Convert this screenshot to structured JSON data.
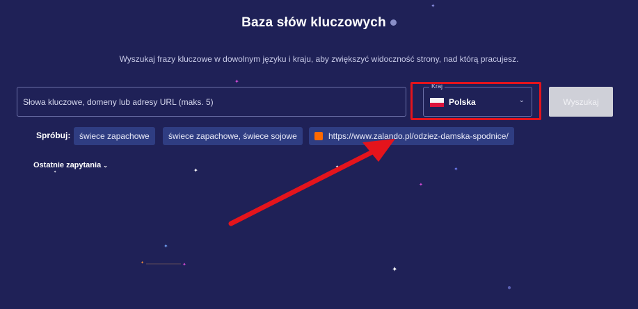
{
  "page": {
    "title": "Baza słów kluczowych",
    "subtitle": "Wyszukaj frazy kluczowe w dowolnym języku i kraju, aby zwiększyć widoczność strony, nad którą pracujesz."
  },
  "search": {
    "placeholder": "Słowa kluczowe, domeny lub adresy URL (maks. 5)",
    "value": ""
  },
  "country": {
    "legend": "Kraj",
    "selected": "Polska",
    "flag_icon": "poland-flag-icon"
  },
  "submit": {
    "label": "Wyszukaj"
  },
  "try": {
    "label": "Spróbuj:",
    "suggestions": [
      "świece zapachowe",
      "świece zapachowe, świece sojowe",
      "https://www.zalando.pl/odziez-damska-spodnice/"
    ]
  },
  "recent": {
    "label": "Ostatnie zapytania"
  },
  "colors": {
    "background": "#1f2157",
    "annotation_red": "#e4141c",
    "chip_bg": "#2f3d82",
    "button_disabled": "#cfd0d8"
  }
}
